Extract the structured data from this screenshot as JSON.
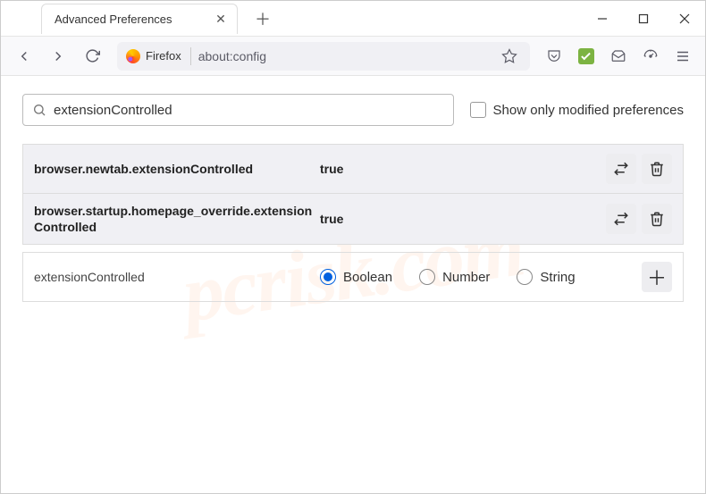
{
  "tab": {
    "title": "Advanced Preferences"
  },
  "addressbar": {
    "identity": "Firefox",
    "url": "about:config"
  },
  "search": {
    "value": "extensionControlled"
  },
  "show_modified_label": "Show only modified preferences",
  "prefs": [
    {
      "name": "browser.newtab.extensionControlled",
      "value": "true"
    },
    {
      "name": "browser.startup.homepage_override.extensionControlled",
      "value": "true"
    }
  ],
  "new_pref": {
    "name": "extensionControlled",
    "types": [
      "Boolean",
      "Number",
      "String"
    ],
    "selected": "Boolean"
  },
  "watermark": "pcrisk.com"
}
